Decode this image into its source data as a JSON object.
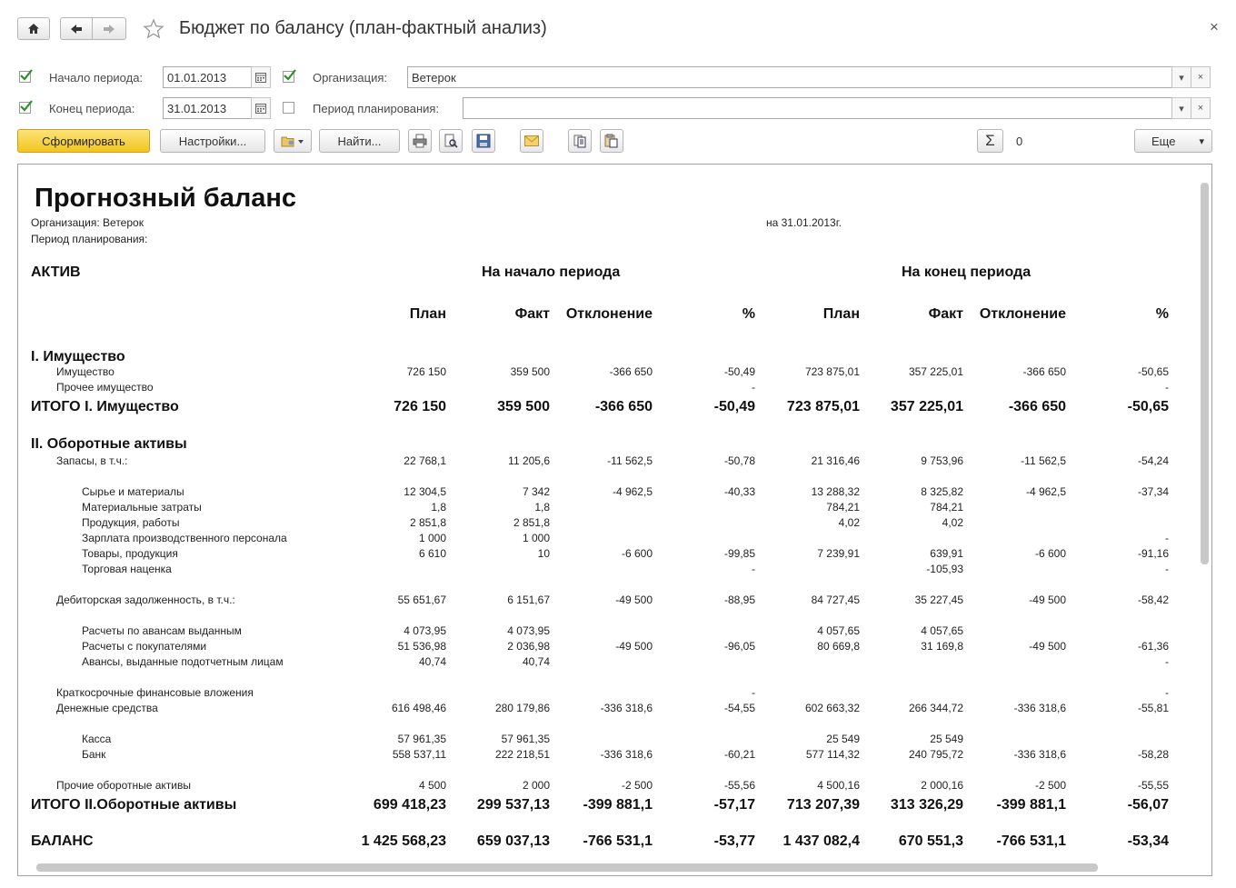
{
  "window": {
    "title": "Бюджет по балансу (план-фактный анализ)",
    "close_glyph": "×"
  },
  "icons": {
    "home": "home-icon",
    "back": "arrow-left-icon",
    "forward": "arrow-right-icon",
    "favorite": "star-icon",
    "calendar": "calendar-icon",
    "dropdown": "chevron-down-icon",
    "clear": "clear-icon",
    "variant": "report-variant-icon",
    "print": "print-icon",
    "preview": "print-preview-icon",
    "save": "save-icon",
    "mail": "mail-icon",
    "copy": "copy-icon",
    "paste": "paste-icon",
    "sum": "sigma-icon"
  },
  "colors": {
    "accent_button": "#f5cf3a",
    "check": "#2e8b2e",
    "scrollbar": "#c8c8c8"
  },
  "filters": {
    "start_label": "Начало периода:",
    "start_value": "01.01.2013",
    "start_checked": true,
    "end_label": "Конец периода:",
    "end_value": "31.01.2013",
    "end_checked": true,
    "org_label": "Организация:",
    "org_value": "Ветерок",
    "org_checked": true,
    "plan_label": "Период планирования:",
    "plan_value": "",
    "plan_checked": false,
    "clear_glyph": "×",
    "dropdown_glyph": "▾"
  },
  "toolbar": {
    "generate": "Сформировать",
    "settings": "Настройки...",
    "find": "Найти...",
    "sum_value": "0",
    "more": "Еще",
    "more_glyph": "▾",
    "sum_glyph": "Σ"
  },
  "report": {
    "title": "Прогнозный баланс",
    "org_line": "Организация: Ветерок",
    "period_line": "Период планирования:",
    "date_line": "на 31.01.2013г.",
    "section_label": "АКТИВ",
    "start_header": "На начало периода",
    "end_header": "На конец периода",
    "columns": [
      "План",
      "Факт",
      "Отклонение",
      "%",
      "План",
      "Факт",
      "Отклонение",
      "%"
    ],
    "rows": [
      {
        "label": "I. Имущество",
        "level": 0,
        "bold": true,
        "vals": [
          "",
          "",
          "",
          "",
          "",
          "",
          "",
          ""
        ]
      },
      {
        "label": "Имущество",
        "level": 1,
        "bold": false,
        "vals": [
          "726 150",
          "359 500",
          "-366 650",
          "-50,49",
          "723 875,01",
          "357 225,01",
          "-366 650",
          "-50,65"
        ]
      },
      {
        "label": "Прочее имущество",
        "level": 1,
        "bold": false,
        "vals": [
          "",
          "",
          "",
          "-",
          "",
          "",
          "",
          "-"
        ]
      },
      {
        "label": "ИТОГО I. Имущество",
        "level": 0,
        "bold": true,
        "vals": [
          "726 150",
          "359 500",
          "-366 650",
          "-50,49",
          "723 875,01",
          "357 225,01",
          "-366 650",
          "-50,65"
        ]
      },
      {
        "label": "II. Оборотные активы",
        "level": 0,
        "bold": true,
        "vals": [
          "",
          "",
          "",
          "",
          "",
          "",
          "",
          ""
        ]
      },
      {
        "label": "Запасы, в т.ч.:",
        "level": 1,
        "bold": false,
        "vals": [
          "22 768,1",
          "11 205,6",
          "-11 562,5",
          "-50,78",
          "21 316,46",
          "9 753,96",
          "-11 562,5",
          "-54,24"
        ]
      },
      {
        "label": "Сырье и материалы",
        "level": 2,
        "bold": false,
        "vals": [
          "12 304,5",
          "7 342",
          "-4 962,5",
          "-40,33",
          "13 288,32",
          "8 325,82",
          "-4 962,5",
          "-37,34"
        ]
      },
      {
        "label": "Материальные затраты",
        "level": 2,
        "bold": false,
        "vals": [
          "1,8",
          "1,8",
          "",
          "",
          "784,21",
          "784,21",
          "",
          ""
        ]
      },
      {
        "label": "Продукция, работы",
        "level": 2,
        "bold": false,
        "vals": [
          "2 851,8",
          "2 851,8",
          "",
          "",
          "4,02",
          "4,02",
          "",
          ""
        ]
      },
      {
        "label": "Зарплата производственного персонала",
        "level": 2,
        "bold": false,
        "vals": [
          "1 000",
          "1 000",
          "",
          "",
          "",
          "",
          "",
          "-"
        ]
      },
      {
        "label": "Товары, продукция",
        "level": 2,
        "bold": false,
        "vals": [
          "6 610",
          "10",
          "-6 600",
          "-99,85",
          "7 239,91",
          "639,91",
          "-6 600",
          "-91,16"
        ]
      },
      {
        "label": "Торговая наценка",
        "level": 2,
        "bold": false,
        "vals": [
          "",
          "",
          "",
          "-",
          "",
          "-105,93",
          "",
          "-"
        ]
      },
      {
        "label": "Дебиторская задолженность, в т.ч.:",
        "level": 1,
        "bold": false,
        "vals": [
          "55 651,67",
          "6 151,67",
          "-49 500",
          "-88,95",
          "84 727,45",
          "35 227,45",
          "-49 500",
          "-58,42"
        ]
      },
      {
        "label": "Расчеты по авансам выданным",
        "level": 2,
        "bold": false,
        "vals": [
          "4 073,95",
          "4 073,95",
          "",
          "",
          "4 057,65",
          "4 057,65",
          "",
          ""
        ]
      },
      {
        "label": "Расчеты с покупателями",
        "level": 2,
        "bold": false,
        "vals": [
          "51 536,98",
          "2 036,98",
          "-49 500",
          "-96,05",
          "80 669,8",
          "31 169,8",
          "-49 500",
          "-61,36"
        ]
      },
      {
        "label": "Авансы, выданные подотчетным лицам",
        "level": 2,
        "bold": false,
        "vals": [
          "40,74",
          "40,74",
          "",
          "",
          "",
          "",
          "",
          "-"
        ]
      },
      {
        "label": "Краткосрочные финансовые вложения",
        "level": 1,
        "bold": false,
        "vals": [
          "",
          "",
          "",
          "-",
          "",
          "",
          "",
          "-"
        ]
      },
      {
        "label": "Денежные средства",
        "level": 1,
        "bold": false,
        "vals": [
          "616 498,46",
          "280 179,86",
          "-336 318,6",
          "-54,55",
          "602 663,32",
          "266 344,72",
          "-336 318,6",
          "-55,81"
        ]
      },
      {
        "label": "Касса",
        "level": 2,
        "bold": false,
        "vals": [
          "57 961,35",
          "57 961,35",
          "",
          "",
          "25 549",
          "25 549",
          "",
          ""
        ]
      },
      {
        "label": "Банк",
        "level": 2,
        "bold": false,
        "vals": [
          "558 537,11",
          "222 218,51",
          "-336 318,6",
          "-60,21",
          "577 114,32",
          "240 795,72",
          "-336 318,6",
          "-58,28"
        ]
      },
      {
        "label": "Прочие оборотные активы",
        "level": 1,
        "bold": false,
        "vals": [
          "4 500",
          "2 000",
          "-2 500",
          "-55,56",
          "4 500,16",
          "2 000,16",
          "-2 500",
          "-55,55"
        ]
      },
      {
        "label": "ИТОГО II.Оборотные активы",
        "level": 0,
        "bold": true,
        "vals": [
          "699 418,23",
          "299 537,13",
          "-399 881,1",
          "-57,17",
          "713 207,39",
          "313 326,29",
          "-399 881,1",
          "-56,07"
        ]
      },
      {
        "label": "БАЛАНС",
        "level": 0,
        "bold": true,
        "vals": [
          "1 425 568,23",
          "659 037,13",
          "-766 531,1",
          "-53,77",
          "1 437 082,4",
          "670 551,3",
          "-766 531,1",
          "-53,34"
        ]
      }
    ]
  }
}
